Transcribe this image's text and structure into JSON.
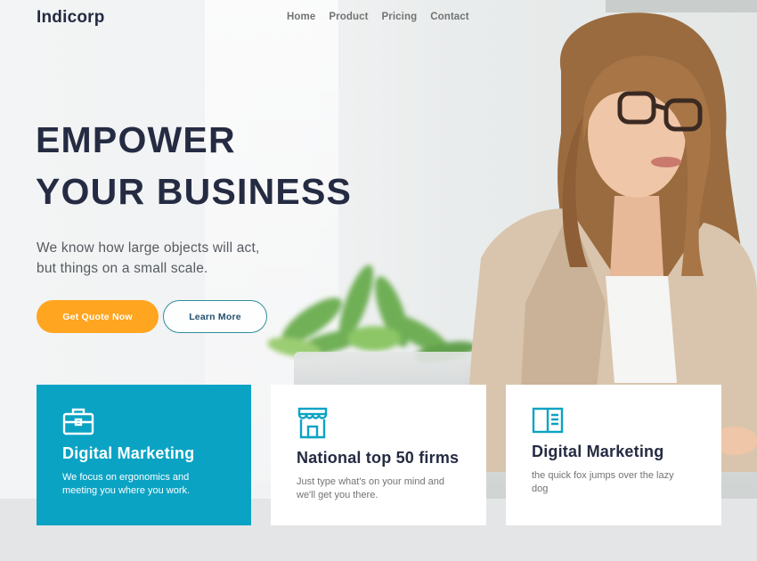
{
  "brand": "Indicorp",
  "nav": [
    "Home",
    "Product",
    "Pricing",
    "Contact"
  ],
  "hero": {
    "title_line1": "EMPOWER",
    "title_line2": "YOUR BUSINESS",
    "subtitle_line1": "We know how large objects will act,",
    "subtitle_line2": "but things on a small scale.",
    "primary_button": "Get Quote Now",
    "secondary_button": "Learn More"
  },
  "cards": [
    {
      "icon": "briefcase-icon",
      "title": "Digital Marketing",
      "text_line1": "We focus on ergonomics and",
      "text_line2": "meeting you where you work."
    },
    {
      "icon": "storefront-icon",
      "title": "National top 50 firms",
      "text_line1": "Just type what's on your mind and",
      "text_line2": "we'll get you there."
    },
    {
      "icon": "book-icon",
      "title": "Digital Marketing",
      "text_line1": "the quick fox jumps over the lazy",
      "text_line2": "dog"
    }
  ],
  "colors": {
    "heading": "#252b42",
    "muted": "#737373",
    "accent_orange": "#ffa51f",
    "accent_teal": "#0ba3c4",
    "outline_blue": "#23a6f0"
  }
}
